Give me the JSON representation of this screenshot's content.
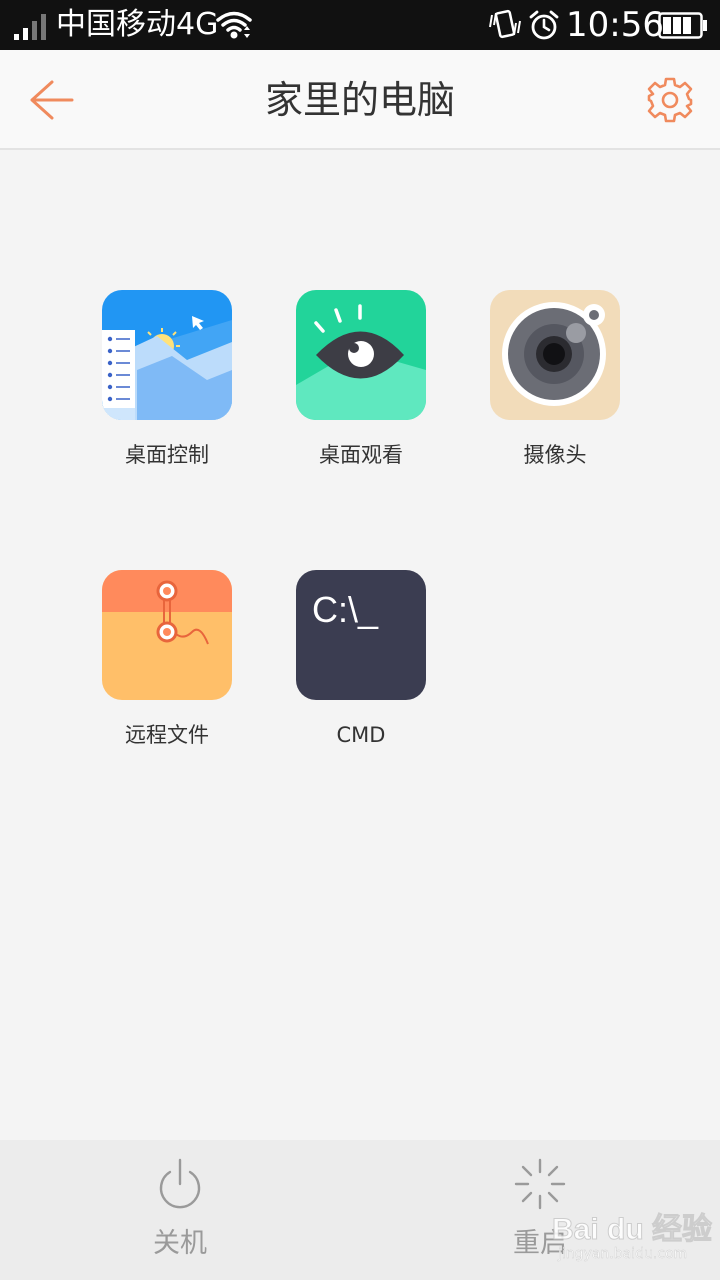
{
  "status_bar": {
    "carrier": "中国移动4G",
    "time": "10:56",
    "icons": [
      "signal-icon",
      "wifi-icon",
      "vibrate-icon",
      "alarm-icon",
      "battery-icon"
    ]
  },
  "header": {
    "title": "家里的电脑",
    "back_icon": "arrow-left-icon",
    "settings_icon": "gear-icon"
  },
  "tiles": [
    {
      "label": "桌面控制",
      "icon": "desktop-control-icon"
    },
    {
      "label": "桌面观看",
      "icon": "eye-icon"
    },
    {
      "label": "摄像头",
      "icon": "camera-icon"
    },
    {
      "label": "远程文件",
      "icon": "folder-file-icon"
    },
    {
      "label": "CMD",
      "icon": "terminal-icon",
      "icon_text": "C:\\_"
    }
  ],
  "bottom_bar": {
    "shutdown_label": "关机",
    "restart_label": "重启"
  },
  "watermark": {
    "main": "Bai du 经验",
    "sub": "jingyan.baidu.com"
  },
  "colors": {
    "accent": "#f08a5d",
    "status_bar": "#111111",
    "background": "#f4f4f4",
    "title_text": "#333333",
    "bottom_label": "#9a9a9a"
  }
}
